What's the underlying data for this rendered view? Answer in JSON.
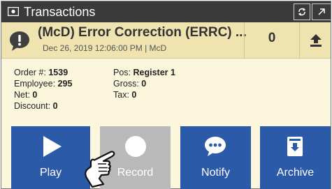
{
  "window": {
    "title": "Transactions",
    "title_icon": "money-icon",
    "controls": [
      {
        "name": "refresh",
        "icon": "refresh-icon"
      },
      {
        "name": "expand",
        "icon": "expand-arrow-icon"
      }
    ]
  },
  "transaction": {
    "title": "(McD) Error Correction (ERRC) ...",
    "subtitle": "Dec 26, 2019 12:06:00 PM | McD",
    "count": "0",
    "icon": "alert-chat-icon",
    "upload_icon": "upload-icon"
  },
  "details": {
    "order_label": "Order #:",
    "order_value": "1539",
    "employee_label": "Employee:",
    "employee_value": "295",
    "net_label": "Net:",
    "net_value": "0",
    "discount_label": "Discount:",
    "discount_value": "0",
    "pos_label": "Pos:",
    "pos_value": "Register 1",
    "gross_label": "Gross:",
    "gross_value": "0",
    "tax_label": "Tax:",
    "tax_value": "0"
  },
  "actions": [
    {
      "label": "Play",
      "icon": "play-icon"
    },
    {
      "label": "Record",
      "icon": "record-icon"
    },
    {
      "label": "Notify",
      "icon": "chat-bubble-icon"
    },
    {
      "label": "Archive",
      "icon": "archive-icon"
    }
  ],
  "colors": {
    "titlebar": "#3a3a3a",
    "panel": "#fcf6dc",
    "header": "#efe3b0",
    "action_blue": "#2a5aa8",
    "action_disabled": "#b9b9b9"
  }
}
